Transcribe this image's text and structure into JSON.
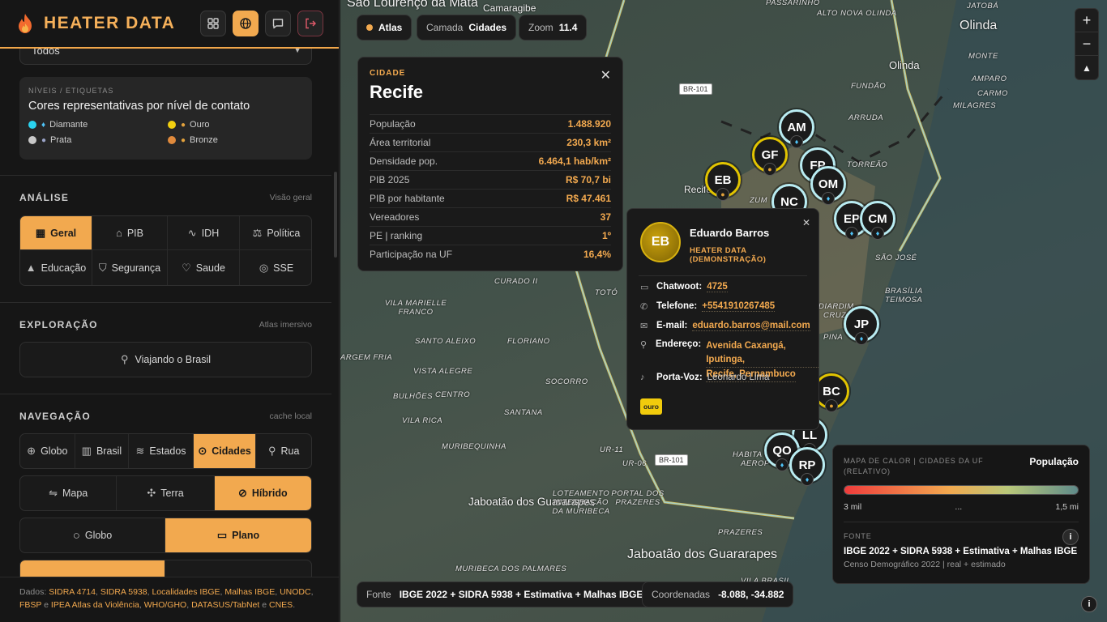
{
  "brand": {
    "title": "HEATER DATA"
  },
  "header_buttons": [
    {
      "name": "grid-icon",
      "active": false
    },
    {
      "name": "globe-icon",
      "active": true
    },
    {
      "name": "chat-icon",
      "active": false
    },
    {
      "name": "logout-icon",
      "active": false
    }
  ],
  "top_select": {
    "value": "Todos"
  },
  "levels": {
    "caption": "NÍVEIS / ETIQUETAS",
    "title": "Cores representativas por nível de contato",
    "items": [
      {
        "label": "Diamante",
        "color": "#2ad3ef",
        "icon": "diamond-icon"
      },
      {
        "label": "Ouro",
        "color": "#f2cf10",
        "icon": "medal-icon"
      },
      {
        "label": "Prata",
        "color": "#c8c8c8",
        "icon": "medal-icon"
      },
      {
        "label": "Bronze",
        "color": "#e08a3c",
        "icon": "medal-icon"
      }
    ]
  },
  "analysis": {
    "heading": "ANÁLISE",
    "sub": "Visão geral",
    "items": [
      {
        "label": "Geral",
        "icon": "dashboard-icon",
        "active": true
      },
      {
        "label": "PIB",
        "icon": "bank-icon",
        "active": false
      },
      {
        "label": "IDH",
        "icon": "pulse-icon",
        "active": false
      },
      {
        "label": "Política",
        "icon": "scale-icon",
        "active": false
      },
      {
        "label": "Educação",
        "icon": "graduation-icon",
        "active": false
      },
      {
        "label": "Segurança",
        "icon": "shield-icon",
        "active": false
      },
      {
        "label": "Saude",
        "icon": "heart-icon",
        "active": false
      },
      {
        "label": "SSE",
        "icon": "target-icon",
        "active": false
      }
    ]
  },
  "exploration": {
    "heading": "EXPLORAÇÃO",
    "sub": "Atlas imersivo",
    "button": "Viajando o Brasil"
  },
  "navigation": {
    "heading": "NAVEGAÇÃO",
    "sub": "cache local",
    "levels": [
      {
        "label": "Globo",
        "active": false
      },
      {
        "label": "Brasil",
        "active": false
      },
      {
        "label": "Estados",
        "active": false
      },
      {
        "label": "Cidades",
        "active": true
      },
      {
        "label": "Rua",
        "active": false
      }
    ],
    "styles": [
      {
        "label": "Mapa",
        "active": false
      },
      {
        "label": "Terra",
        "active": false
      },
      {
        "label": "Híbrido",
        "active": true
      }
    ],
    "projection": [
      {
        "label": "Globo",
        "active": false
      },
      {
        "label": "Plano",
        "active": true
      }
    ]
  },
  "footer": {
    "prefix": "Dados: ",
    "sources": [
      "SIDRA 4714",
      "SIDRA 5938",
      "Localidades IBGE",
      "Malhas IBGE",
      "UNODC",
      "FBSP",
      "IPEA Atlas da Violência",
      "WHO/GHO",
      "DATASUS/TabNet",
      "CNES"
    ],
    "and": "e"
  },
  "map": {
    "chips": {
      "atlas": "Atlas",
      "layer_label": "Camada",
      "layer_value": "Cidades",
      "zoom_label": "Zoom",
      "zoom_value": "11.4"
    },
    "labels": [
      "São Lourenço da Mata",
      "Camaragibe",
      "PASSARINHO",
      "ALTO NOVA OLINDA",
      "JATOBÁ",
      "Olinda",
      "Olinda",
      "MONTE",
      "AMPARO",
      "CARMO",
      "MILAGRES",
      "FUNDÃO",
      "ARRUDA",
      "TORREÃO",
      "SÃO JOSÉ",
      "BRASÍLIA TEIMOSA",
      "CURADO II",
      "VILA MARIELLE FRANCO",
      "SANTO ALEIXO",
      "FLORIANO",
      "ARGEM FRIA",
      "VISTA ALEGRE",
      "SOCORRO",
      "BULHÕES",
      "CENTRO",
      "SANTANA",
      "VILA RICA",
      "MURIBEQUINHA",
      "UR-11",
      "UR-06",
      "Jaboatão dos Guararapes",
      "LOTEAMENTO INTEGRAÇÃO DA MURIBECA",
      "PORTAL DOS PRAZERES",
      "PRAZERES",
      "Jaboatão dos Guararapes",
      "MURIBECA DOS PALMARES",
      "VILA BRASIL",
      "Recife",
      "ZUM",
      "DIARDIM",
      "PINA",
      "HABITA",
      "AEROP",
      "CRUZ",
      "TOTÓ"
    ],
    "road_tags": [
      "BR-101",
      "BR-101"
    ],
    "markers": [
      {
        "code": "AM",
        "tier": "diamante"
      },
      {
        "code": "GF",
        "tier": "ouro"
      },
      {
        "code": "FP",
        "tier": "diamante"
      },
      {
        "code": "EB",
        "tier": "ouro"
      },
      {
        "code": "OM",
        "tier": "diamante"
      },
      {
        "code": "NC",
        "tier": "diamante"
      },
      {
        "code": "EP",
        "tier": "diamante"
      },
      {
        "code": "CM",
        "tier": "diamante"
      },
      {
        "code": "JP",
        "tier": "diamante"
      },
      {
        "code": "BC",
        "tier": "ouro"
      },
      {
        "code": "LL",
        "tier": "diamante"
      },
      {
        "code": "QO",
        "tier": "diamante"
      },
      {
        "code": "RP",
        "tier": "diamante"
      }
    ]
  },
  "city_card": {
    "kind": "CIDADE",
    "name": "Recife",
    "rows": [
      {
        "k": "População",
        "v": "1.488.920"
      },
      {
        "k": "Área territorial",
        "v": "230,3 km²"
      },
      {
        "k": "Densidade pop.",
        "v": "6.464,1 hab/km²"
      },
      {
        "k": "PIB 2025",
        "v": "R$ 70,7 bi"
      },
      {
        "k": "PIB por habitante",
        "v": "R$ 47.461"
      },
      {
        "k": "Vereadores",
        "v": "37"
      },
      {
        "k": "PE | ranking",
        "v": "1º"
      },
      {
        "k": "Participação na UF",
        "v": "16,4%"
      }
    ]
  },
  "contact_card": {
    "initials": "EB",
    "name": "Eduardo Barros",
    "org": "HEATER DATA (DEMONSTRAÇÃO)",
    "chatwoot_label": "Chatwoot:",
    "chatwoot": "4725",
    "phone_label": "Telefone:",
    "phone": "+5541910267485",
    "email_label": "E-mail:",
    "email": "eduardo.barros@mail.com",
    "address_label": "Endereço:",
    "address_1": "Avenida Caxangá, Iputinga,",
    "address_2": "Recife, Pernambuco",
    "spokesperson_label": "Porta-Voz:",
    "spokesperson": "Leonardo Lima",
    "tier": "ouro"
  },
  "heatmap": {
    "title": "MAPA DE CALOR | CIDADES DA UF (RELATIVO)",
    "metric": "População",
    "min": "3 mil",
    "mid": "...",
    "max": "1,5 mi",
    "source_label": "FONTE",
    "source": "IBGE 2022 + SIDRA 5938 + Estimativa + Malhas IBGE",
    "source_detail": "Censo Demográfico 2022 | real + estimado"
  },
  "bottom_bar": {
    "source_label": "Fonte",
    "source": "IBGE 2022 + SIDRA 5938 + Estimativa + Malhas IBGE",
    "coords_label": "Coordenadas",
    "coords": "-8.088, -34.882"
  }
}
